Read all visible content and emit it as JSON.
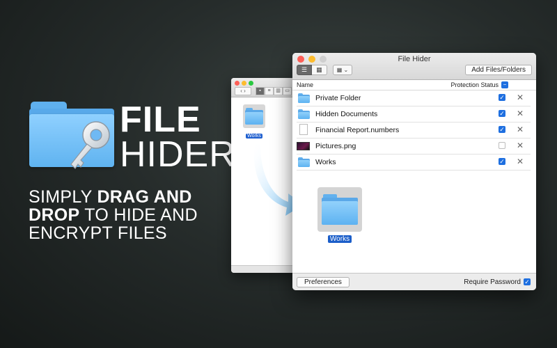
{
  "hero": {
    "title_line1": "FILE",
    "title_line2": "HIDER",
    "tagline_part1": "SIMPLY ",
    "tagline_bold": "DRAG AND DROP",
    "tagline_part2": " TO HIDE AND ENCRYPT FILES"
  },
  "finder": {
    "item_label": "Works",
    "nav_label": "‹ ›"
  },
  "window": {
    "title": "File Hider",
    "add_button": "Add Files/Folders",
    "column_name": "Name",
    "column_protection": "Protection Status",
    "rows": [
      {
        "name": "Private Folder",
        "icon": "folder-icon",
        "protected": true
      },
      {
        "name": "Hidden Documents",
        "icon": "folder-icon",
        "protected": true
      },
      {
        "name": "Financial Report.numbers",
        "icon": "document-icon",
        "protected": true
      },
      {
        "name": "Pictures.png",
        "icon": "image-icon",
        "protected": false
      },
      {
        "name": "Works",
        "icon": "folder-icon",
        "protected": true
      }
    ],
    "dropped_item_label": "Works",
    "preferences_button": "Preferences",
    "require_password_label": "Require Password",
    "require_password_checked": true,
    "remove_glyph": "✕",
    "check_glyph": "✓"
  },
  "colors": {
    "accent": "#1e6fe0",
    "folder_blue": "#5fb3f0",
    "background": "#262c2b"
  }
}
